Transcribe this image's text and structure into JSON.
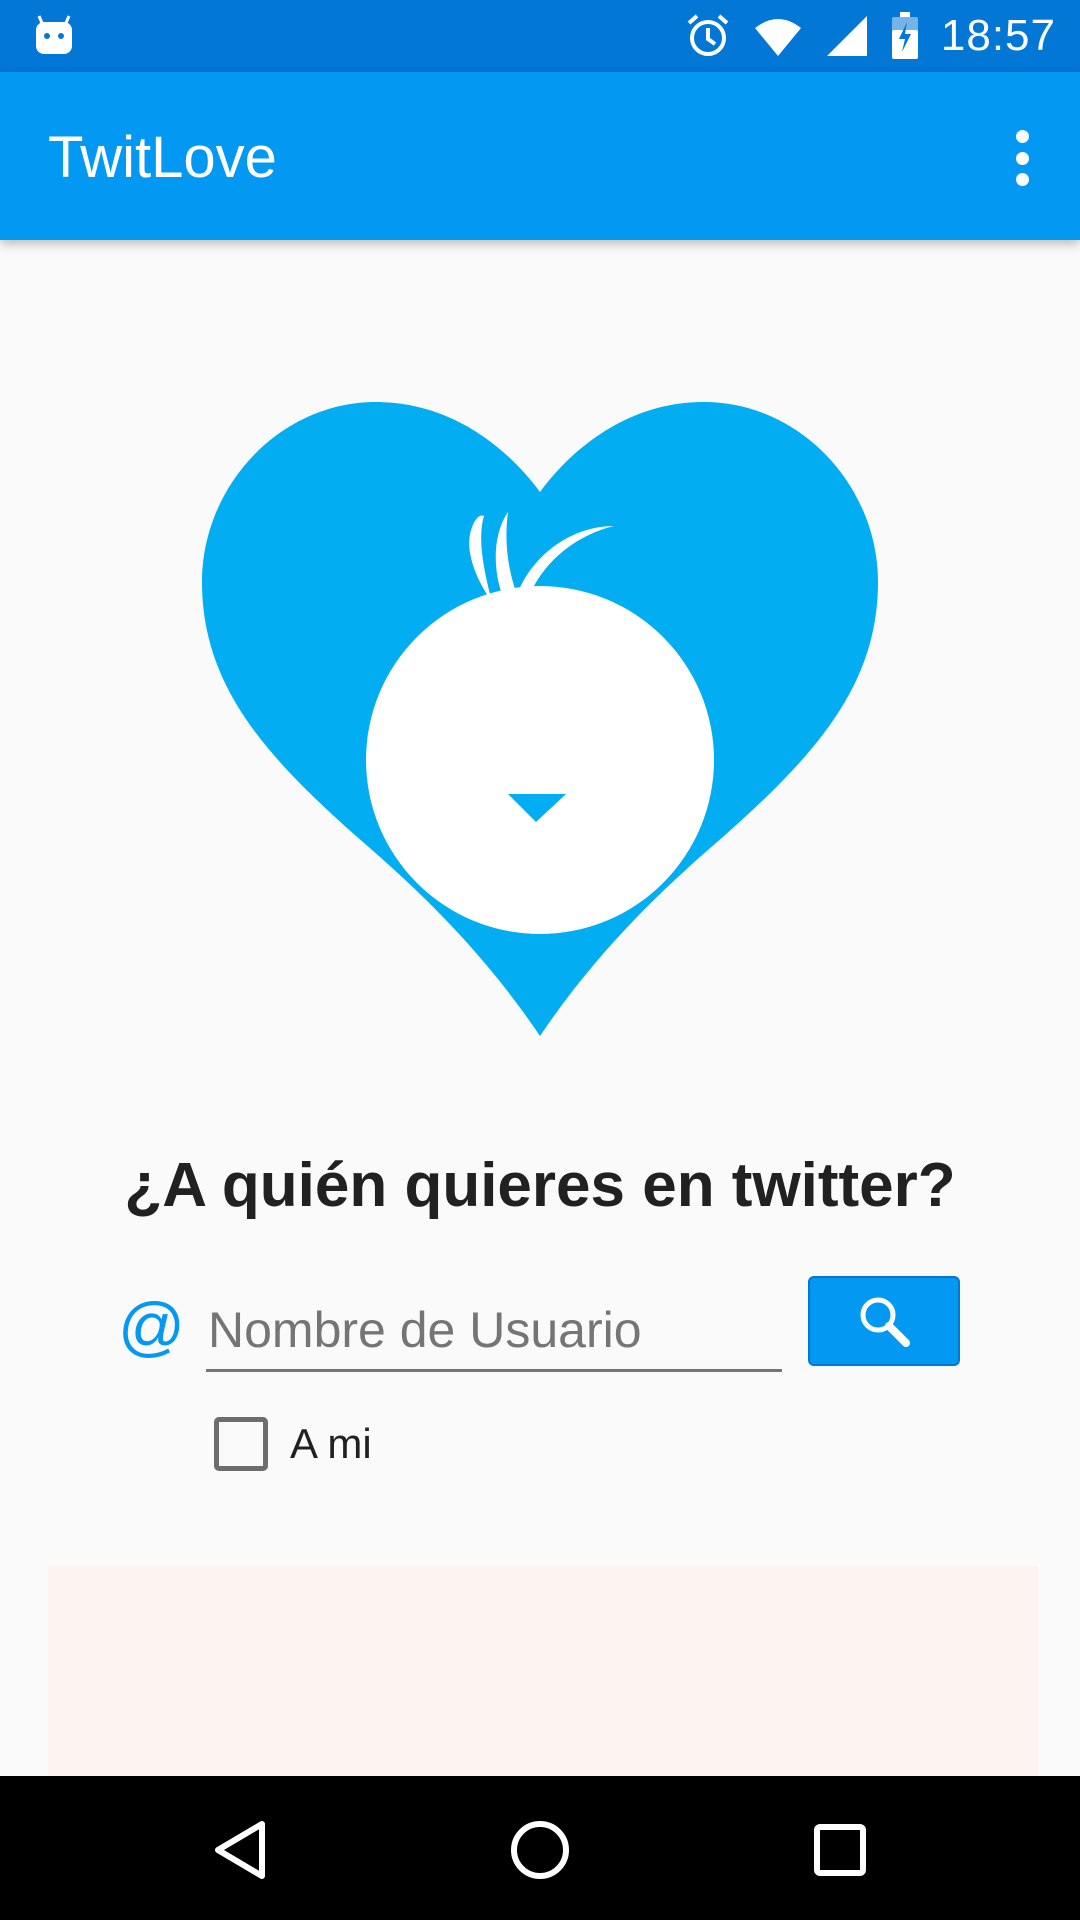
{
  "status_bar": {
    "time": "18:57",
    "icons": [
      "android-notification-icon",
      "alarm-icon",
      "wifi-icon",
      "cell-signal-icon",
      "battery-charging-icon"
    ]
  },
  "app_bar": {
    "title": "TwitLove",
    "menu_icon": "overflow-menu-icon"
  },
  "main": {
    "logo_icon": "heart-bird-logo",
    "headline": "¿A quién quieres en twitter?",
    "at_symbol": "@",
    "username_field": {
      "value": "",
      "placeholder": "Nombre de Usuario"
    },
    "search_icon": "search-icon",
    "self_checkbox": {
      "label": "A mi",
      "checked": false
    }
  },
  "nav_bar": {
    "icons": [
      "back-icon",
      "home-icon",
      "recents-icon"
    ]
  },
  "colors": {
    "status_bar": "#0277d6",
    "app_bar": "#0399f3",
    "logo_heart": "#02adf2",
    "background": "#fafafa",
    "ad_area": "#fdf4f2"
  }
}
